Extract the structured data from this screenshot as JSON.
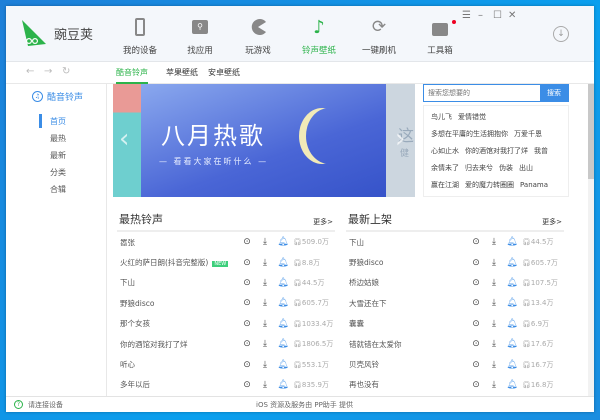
{
  "app": {
    "name": "豌豆荚"
  },
  "nav": [
    {
      "label": "我的设备",
      "icon": "phone-icon"
    },
    {
      "label": "找应用",
      "icon": "search-app-icon"
    },
    {
      "label": "玩游戏",
      "icon": "pacman-icon"
    },
    {
      "label": "铃声壁纸",
      "icon": "music-note-icon"
    },
    {
      "label": "一键刷机",
      "icon": "refresh-icon"
    },
    {
      "label": "工具箱",
      "icon": "toolbox-icon"
    }
  ],
  "subtabs": [
    "酷音铃声",
    "苹果壁纸",
    "安卓壁纸"
  ],
  "sidebar": {
    "title": "酷音铃声",
    "items": [
      "首页",
      "最热",
      "最新",
      "分类",
      "合辑"
    ]
  },
  "banner": {
    "title": "八月热歌",
    "subtitle": "— 看看大家在听什么 —",
    "next_peek": "这",
    "next_peek2": "健"
  },
  "search": {
    "placeholder": "搜索您想要的",
    "button": "搜索"
  },
  "tags": [
    [
      "鸟儿飞",
      "爱情错觉"
    ],
    [
      "多想在平庸的生活拥抱你",
      "万爱千恩"
    ],
    [
      "心如止水",
      "你的酒馆对我打了烊",
      "我曾"
    ],
    [
      "余情未了",
      "归去来兮",
      "伪装",
      "出山"
    ],
    [
      "赢在江湖",
      "爱的魔力转圈圈",
      "Panama"
    ]
  ],
  "hot": {
    "title": "最热铃声",
    "more": "更多>",
    "badge": "NEW",
    "rows": [
      {
        "name": "嚣张",
        "count": "509.0万"
      },
      {
        "name": "火红的萨日朗(抖音完整版)",
        "count": "8.8万",
        "new": true
      },
      {
        "name": "下山",
        "count": "44.5万"
      },
      {
        "name": "野狼disco",
        "count": "605.7万"
      },
      {
        "name": "那个女孩",
        "count": "1033.4万"
      },
      {
        "name": "你的酒馆对我打了烊",
        "count": "1806.5万"
      },
      {
        "name": "听心",
        "count": "553.1万"
      },
      {
        "name": "多年以后",
        "count": "835.9万"
      }
    ]
  },
  "latest": {
    "title": "最新上架",
    "more": "更多>",
    "rows": [
      {
        "name": "下山",
        "count": "44.5万"
      },
      {
        "name": "野狼disco",
        "count": "605.7万"
      },
      {
        "name": "桥边姑娘",
        "count": "107.5万"
      },
      {
        "name": "大雪还在下",
        "count": "13.4万"
      },
      {
        "name": "囊囊",
        "count": "6.9万"
      },
      {
        "name": "错就错在太爱你",
        "count": "17.6万"
      },
      {
        "name": "贝壳风铃",
        "count": "16.7万"
      },
      {
        "name": "再也没有",
        "count": "16.8万"
      }
    ]
  },
  "status": {
    "left": "请连接设备",
    "center": "iOS 资源及服务由 PP助手 提供"
  },
  "colors": {
    "green": "#2cb34a",
    "blue": "#3b8de6"
  }
}
